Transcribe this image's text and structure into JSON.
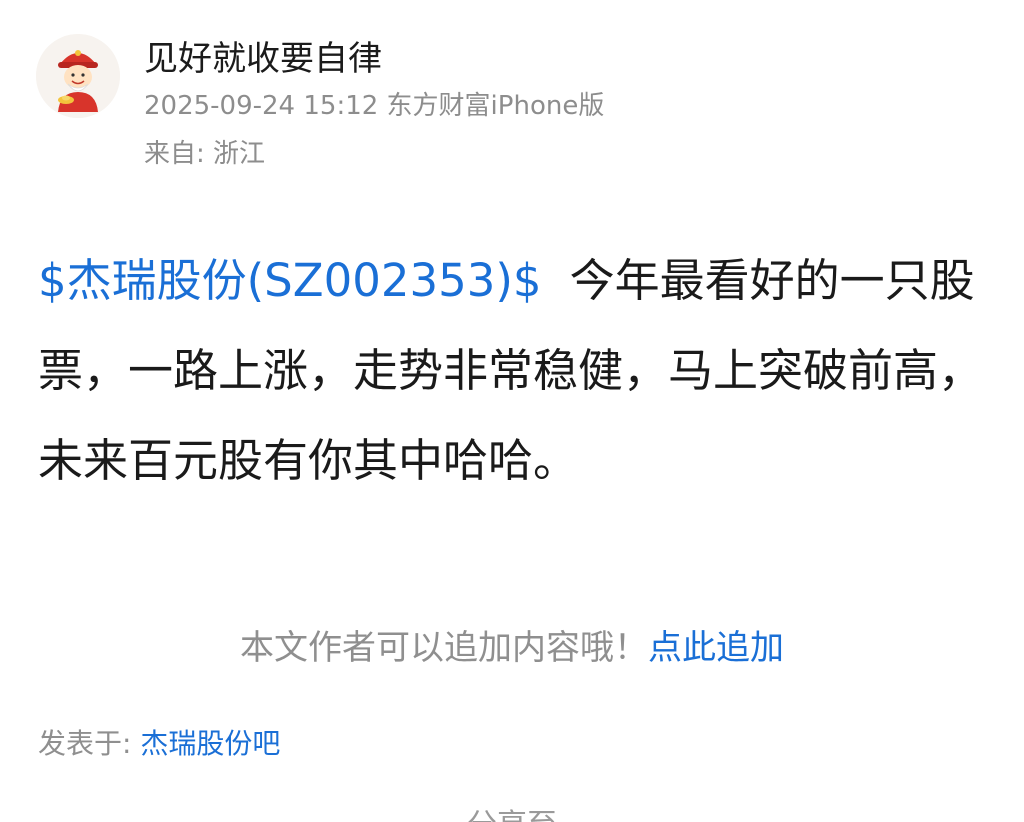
{
  "author": {
    "name": "见好就收要自律",
    "avatar_icon": "fortune-god-avatar-icon"
  },
  "meta": {
    "timestamp_source": "2025-09-24 15:12 东方财富iPhone版",
    "location": "来自: 浙江"
  },
  "post": {
    "stock_tag": "$杰瑞股份(SZ002353)$",
    "text": "今年最看好的一只股票，一路上涨，走势非常稳健，马上突破前高，未来百元股有你其中哈哈。"
  },
  "append": {
    "prompt": "本文作者可以追加内容哦！",
    "link_label": "点此追加"
  },
  "posted_in": {
    "label": "发表于: ",
    "forum": "杰瑞股份吧"
  },
  "bottom_cut_text": "分享至",
  "colors": {
    "link_blue": "#1a6fd6",
    "meta_gray": "#8d8d8d",
    "text_dark": "#1a1a1a"
  }
}
